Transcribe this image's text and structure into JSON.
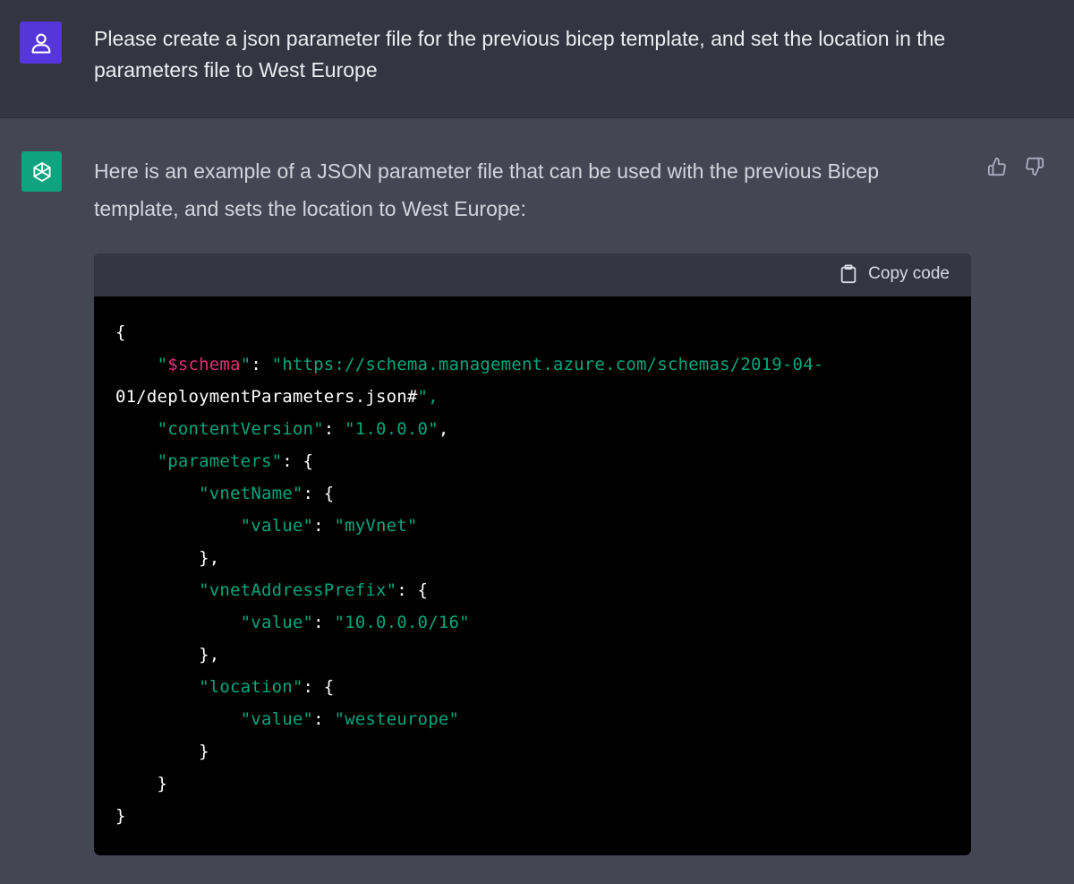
{
  "user_message": {
    "text": "Please create a json parameter file for the previous bicep template, and set the location in the parameters file to West Europe"
  },
  "assistant_message": {
    "text": "Here is an example of a JSON parameter file that can be used with the previous Bicep template, and sets the location to West Europe:",
    "code_block": {
      "copy_label": "Copy code",
      "lines": [
        "{",
        "    \"$schema\": \"https://schema.management.azure.com/schemas/2019-04-",
        "01/deploymentParameters.json#\",",
        "    \"contentVersion\": \"1.0.0.0\",",
        "    \"parameters\": {",
        "        \"vnetName\": {",
        "            \"value\": \"myVnet\"",
        "        },",
        "        \"vnetAddressPrefix\": {",
        "            \"value\": \"10.0.0.0/16\"",
        "        },",
        "        \"location\": {",
        "            \"value\": \"westeurope\"",
        "        }",
        "    }",
        "}"
      ]
    }
  },
  "icons": {
    "user_avatar": "user-icon",
    "assistant_avatar": "openai-logo-icon",
    "thumbs_up": "thumbs-up-icon",
    "thumbs_down": "thumbs-down-icon",
    "copy": "clipboard-icon"
  },
  "colors": {
    "user_bg": "#343541",
    "assistant_bg": "#444654",
    "user_avatar_bg": "#5436da",
    "assistant_avatar_bg": "#10a37f",
    "code_bg": "#000000",
    "code_header_bg": "#343541",
    "string_color": "#00a67d",
    "key_color": "#df3079"
  }
}
